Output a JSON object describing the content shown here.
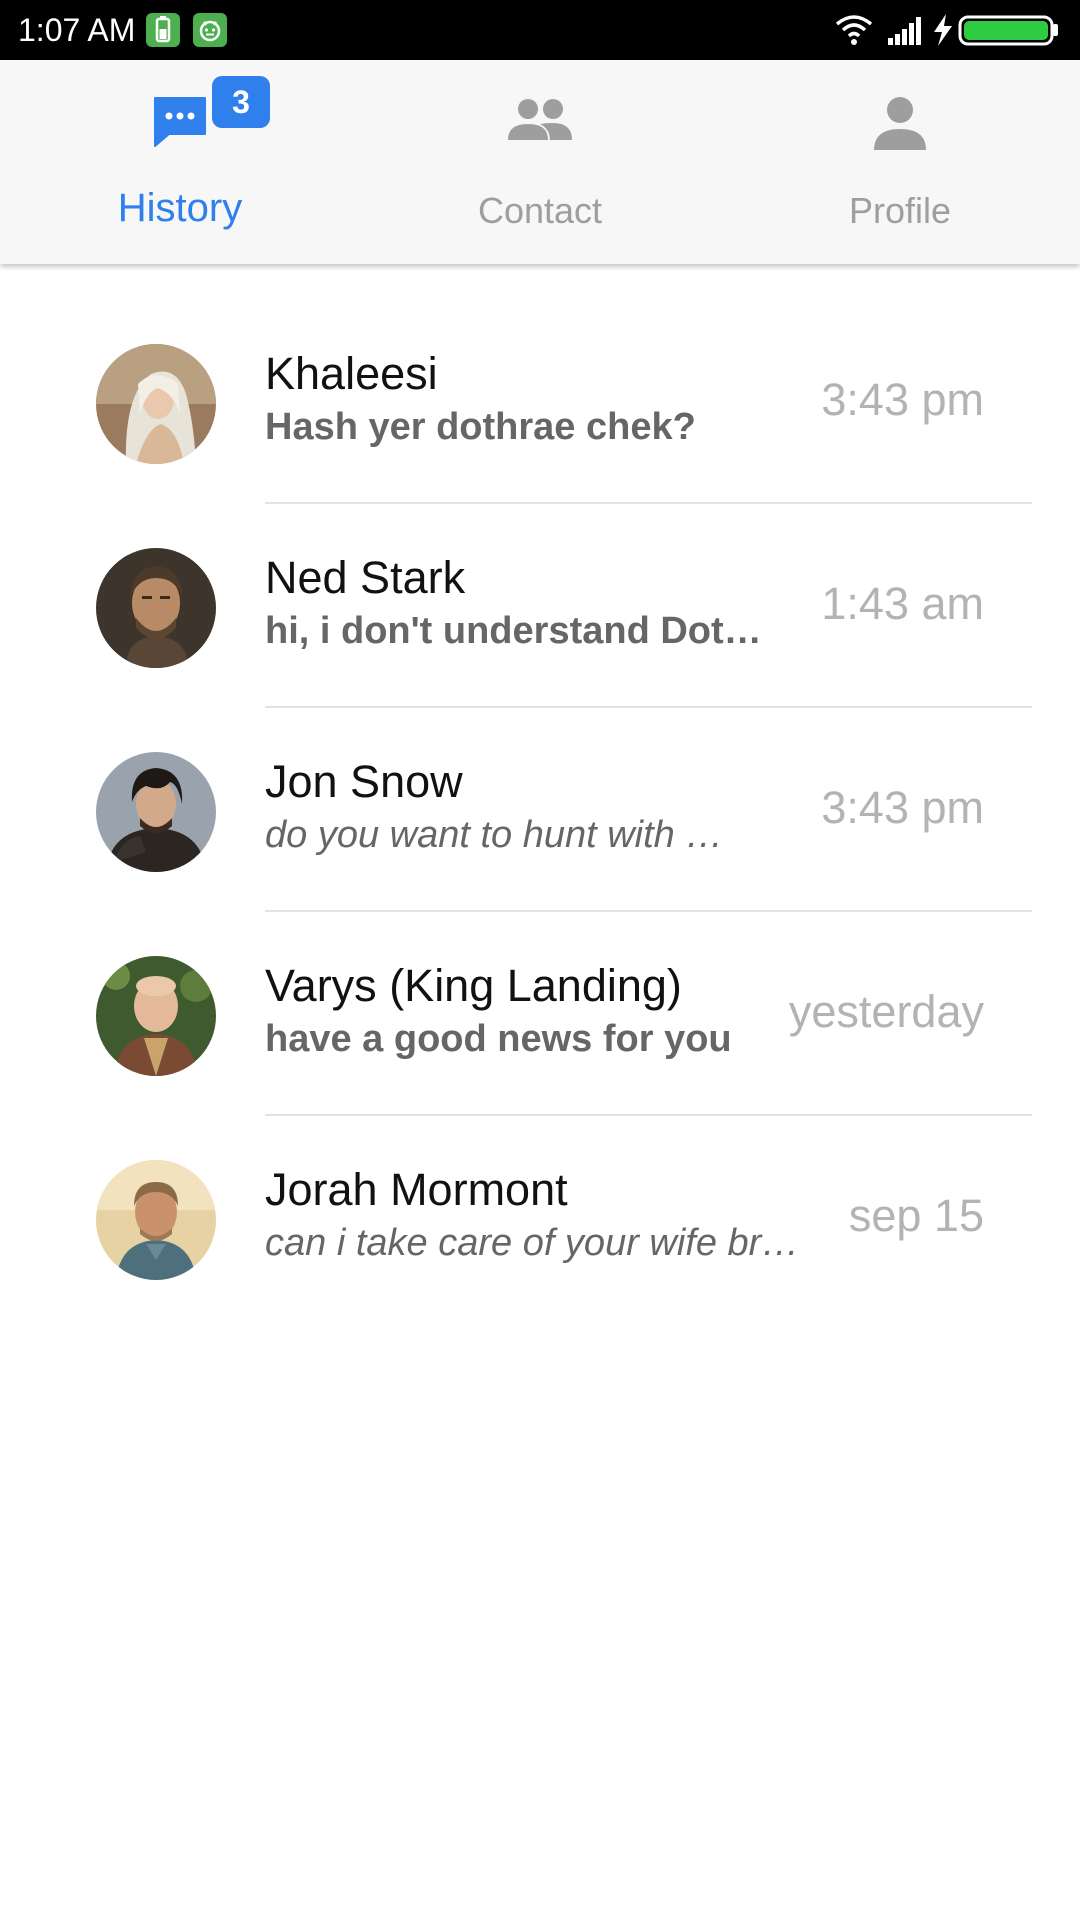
{
  "status_bar": {
    "time": "1:07 AM",
    "left_icons": [
      "battery-saver-icon",
      "android-app-icon"
    ],
    "right_icons": [
      "wifi-icon",
      "signal-icon",
      "charging-icon",
      "battery-icon"
    ],
    "battery_fill": 1.0
  },
  "tabs": [
    {
      "label": "History",
      "icon": "chat-bubble-icon",
      "active": true,
      "badge": "3"
    },
    {
      "label": "Contact",
      "icon": "people-icon",
      "active": false
    },
    {
      "label": "Profile",
      "icon": "person-icon",
      "active": false
    }
  ],
  "colors": {
    "accent": "#2f80ed",
    "inactive_tab": "#9e9e9e",
    "tab_bar_bg": "#f7f7f7",
    "time_text": "#b3b3b3",
    "preview_text": "#666666",
    "battery_green": "#2ecc40"
  },
  "conversations": [
    {
      "name": "Khaleesi",
      "preview": "Hash yer dothrae chek?",
      "preview_style": "bold",
      "time": "3:43 pm",
      "avatar": "khaleesi-avatar"
    },
    {
      "name": "Ned Stark",
      "preview": "hi, i don't understand Dothraki",
      "preview_style": "bold",
      "time": "1:43 am",
      "avatar": "ned-stark-avatar"
    },
    {
      "name": "Jon Snow",
      "preview": "do you want to hunt with me?",
      "preview_style": "italic",
      "time": "3:43 pm",
      "avatar": "jon-snow-avatar"
    },
    {
      "name": "Varys (King Landing)",
      "preview": "have a good news for you",
      "preview_style": "bold",
      "time": "yesterday",
      "avatar": "varys-avatar"
    },
    {
      "name": "Jorah Mormont",
      "preview": "can i take care of your wife brother",
      "preview_style": "italic",
      "time": "sep 15",
      "avatar": "jorah-mormont-avatar"
    }
  ]
}
